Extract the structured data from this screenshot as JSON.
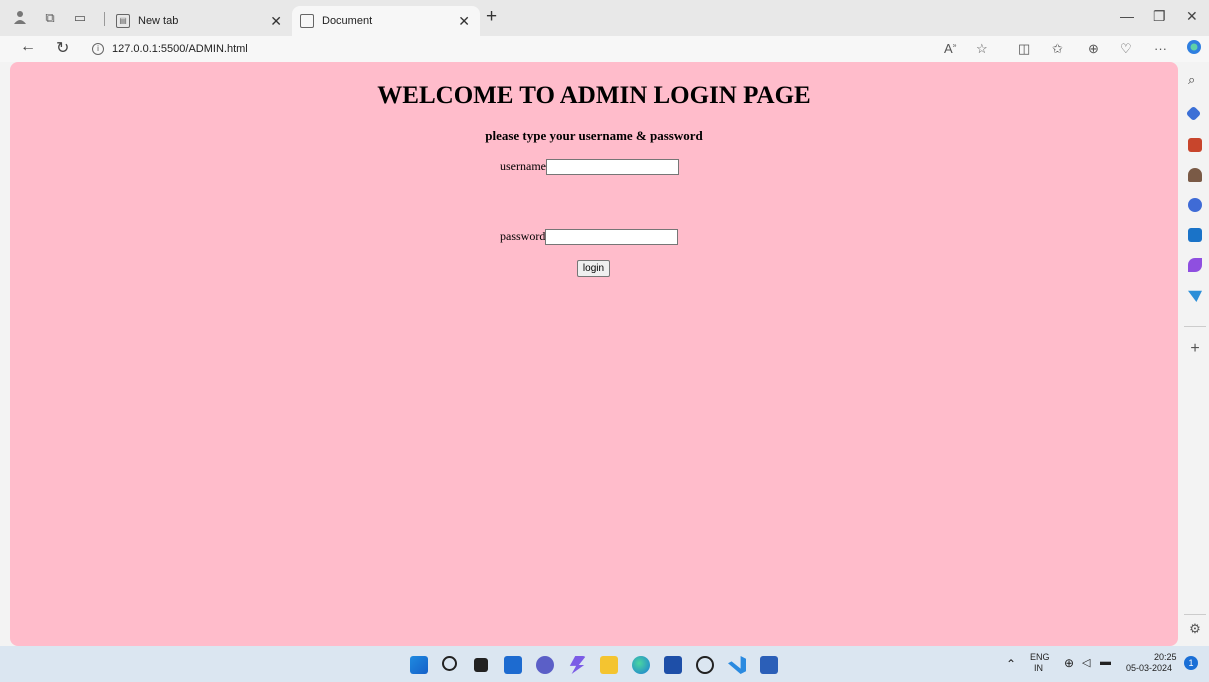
{
  "browser": {
    "tabs": [
      {
        "label": "New tab",
        "active": false
      },
      {
        "label": "Document",
        "active": true
      }
    ],
    "url": "127.0.0.1:5500/ADMIN.html"
  },
  "page": {
    "heading": "WELCOME TO ADMIN LOGIN PAGE",
    "subheading": "please type your username & password",
    "username_label": "username",
    "password_label": "password",
    "login_label": "login",
    "background_color": "#ffbccb"
  },
  "taskbar": {
    "lang_top": "ENG",
    "lang_bottom": "IN",
    "time": "20:25",
    "date": "05-03-2024",
    "notification_count": "1"
  }
}
